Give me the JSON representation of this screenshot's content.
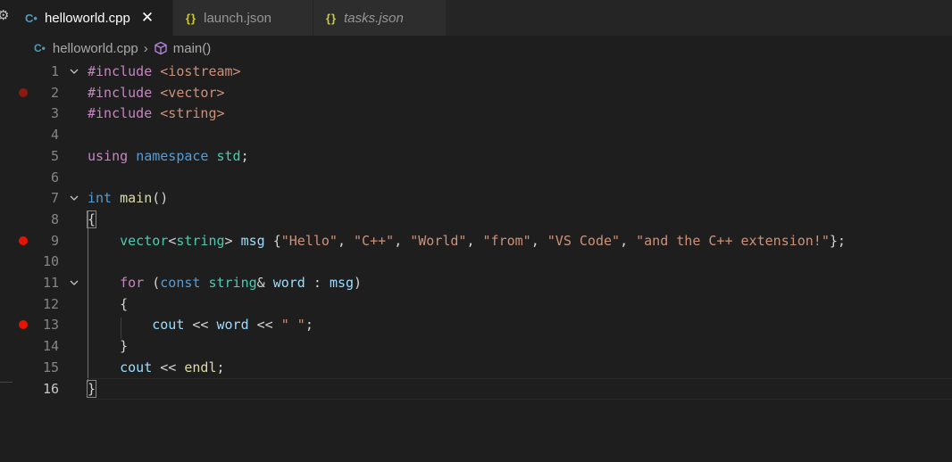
{
  "activity": {
    "gear_icon": "gear-icon"
  },
  "tabs": [
    {
      "label": "helloworld.cpp",
      "icon": "C•",
      "close": "✕"
    },
    {
      "label": "launch.json",
      "icon": "{}"
    },
    {
      "label": "tasks.json",
      "icon": "{}"
    }
  ],
  "breadcrumb": {
    "icon": "C•",
    "file": "helloworld.cpp",
    "sep": "›",
    "symbol": "main()"
  },
  "editor": {
    "line_numbers": [
      "1",
      "2",
      "3",
      "4",
      "5",
      "6",
      "7",
      "8",
      "9",
      "10",
      "11",
      "12",
      "13",
      "14",
      "15",
      "16"
    ],
    "lines": [
      [
        [
          "tok-pre",
          "#include "
        ],
        [
          "tok-inc",
          "<iostream>"
        ]
      ],
      [
        [
          "tok-pre",
          "#include "
        ],
        [
          "tok-inc",
          "<vector>"
        ]
      ],
      [
        [
          "tok-pre",
          "#include "
        ],
        [
          "tok-inc",
          "<string>"
        ]
      ],
      [],
      [
        [
          "tok-ctl",
          "using "
        ],
        [
          "tok-kw",
          "namespace "
        ],
        [
          "tok-type",
          "std"
        ],
        [
          "tok-pun",
          ";"
        ]
      ],
      [],
      [
        [
          "tok-kw",
          "int "
        ],
        [
          "tok-fn",
          "main"
        ],
        [
          "tok-pun",
          "()"
        ]
      ],
      [
        [
          "tok-brc brace-hl",
          "{"
        ]
      ],
      [
        [
          "tok-pun",
          "    "
        ],
        [
          "tok-type",
          "vector"
        ],
        [
          "tok-pun",
          "<"
        ],
        [
          "tok-type",
          "string"
        ],
        [
          "tok-pun",
          "> "
        ],
        [
          "tok-var",
          "msg "
        ],
        [
          "tok-pun",
          "{"
        ],
        [
          "tok-str",
          "\"Hello\""
        ],
        [
          "tok-pun",
          ", "
        ],
        [
          "tok-str",
          "\"C++\""
        ],
        [
          "tok-pun",
          ", "
        ],
        [
          "tok-str",
          "\"World\""
        ],
        [
          "tok-pun",
          ", "
        ],
        [
          "tok-str",
          "\"from\""
        ],
        [
          "tok-pun",
          ", "
        ],
        [
          "tok-str",
          "\"VS Code\""
        ],
        [
          "tok-pun",
          ", "
        ],
        [
          "tok-str",
          "\"and the C++ extension!\""
        ],
        [
          "tok-pun",
          "};"
        ]
      ],
      [],
      [
        [
          "tok-pun",
          "    "
        ],
        [
          "tok-ctl",
          "for "
        ],
        [
          "tok-pun",
          "("
        ],
        [
          "tok-kw",
          "const "
        ],
        [
          "tok-type",
          "string"
        ],
        [
          "tok-pun",
          "& "
        ],
        [
          "tok-var",
          "word "
        ],
        [
          "tok-pun",
          ": "
        ],
        [
          "tok-var",
          "msg"
        ],
        [
          "tok-pun",
          ")"
        ]
      ],
      [
        [
          "tok-pun",
          "    {"
        ]
      ],
      [
        [
          "tok-pun",
          "        "
        ],
        [
          "tok-var",
          "cout "
        ],
        [
          "tok-pun",
          "<< "
        ],
        [
          "tok-var",
          "word "
        ],
        [
          "tok-pun",
          "<< "
        ],
        [
          "tok-str",
          "\" \""
        ],
        [
          "tok-pun",
          ";"
        ]
      ],
      [
        [
          "tok-pun",
          "    }"
        ]
      ],
      [
        [
          "tok-pun",
          "    "
        ],
        [
          "tok-var",
          "cout "
        ],
        [
          "tok-pun",
          "<< "
        ],
        [
          "tok-fn",
          "endl"
        ],
        [
          "tok-pun",
          ";"
        ]
      ],
      [
        [
          "tok-brc brace-hl",
          "}"
        ]
      ]
    ],
    "breakpoints": {
      "2": "faded",
      "9": "active",
      "13": "active"
    },
    "folds": [
      "1",
      "7",
      "11"
    ],
    "current_line": "16"
  }
}
